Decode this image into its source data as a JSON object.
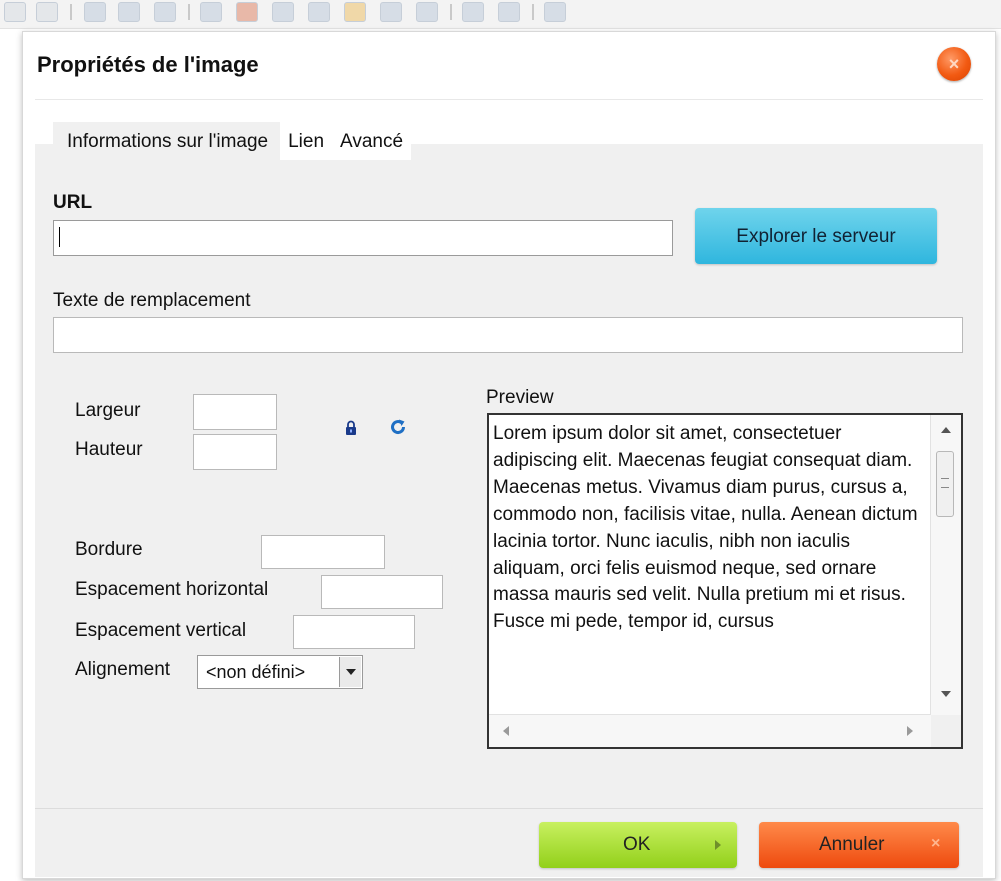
{
  "dialog": {
    "title": "Propriétés de l'image",
    "close_icon": "close-icon"
  },
  "tabs": [
    {
      "label": "Informations sur l'image",
      "active": true
    },
    {
      "label": "Lien",
      "active": false
    },
    {
      "label": "Avancé",
      "active": false
    }
  ],
  "form": {
    "url_label": "URL",
    "url_value": "",
    "browse_label": "Explorer le serveur",
    "alt_label": "Texte de remplacement",
    "alt_value": "",
    "width_label": "Largeur",
    "height_label": "Hauteur",
    "width_value": "",
    "height_value": "",
    "lock_icon": "lock-icon",
    "reset_icon": "reset-size-icon",
    "border_label": "Bordure",
    "border_value": "",
    "hspace_label": "Espacement horizontal",
    "hspace_value": "",
    "vspace_label": "Espacement vertical",
    "vspace_value": "",
    "align_label": "Alignement",
    "align_value": "<non défini>"
  },
  "preview": {
    "label": "Preview",
    "text": "Lorem ipsum dolor sit amet, consectetuer adipiscing elit. Maecenas feugiat consequat diam. Maecenas metus. Vivamus diam purus, cursus a, commodo non, facilisis vitae, nulla. Aenean dictum lacinia tortor. Nunc iaculis, nibh non iaculis aliquam, orci felis euismod neque, sed ornare massa mauris sed velit. Nulla pretium mi et risus. Fusce mi pede, tempor id, cursus"
  },
  "footer": {
    "ok_label": "OK",
    "cancel_label": "Annuler"
  },
  "colors": {
    "ok_button": "#92d01a",
    "cancel_button": "#ee4a0e",
    "browse_button": "#2fb6de",
    "close_button": "#f25a12"
  }
}
